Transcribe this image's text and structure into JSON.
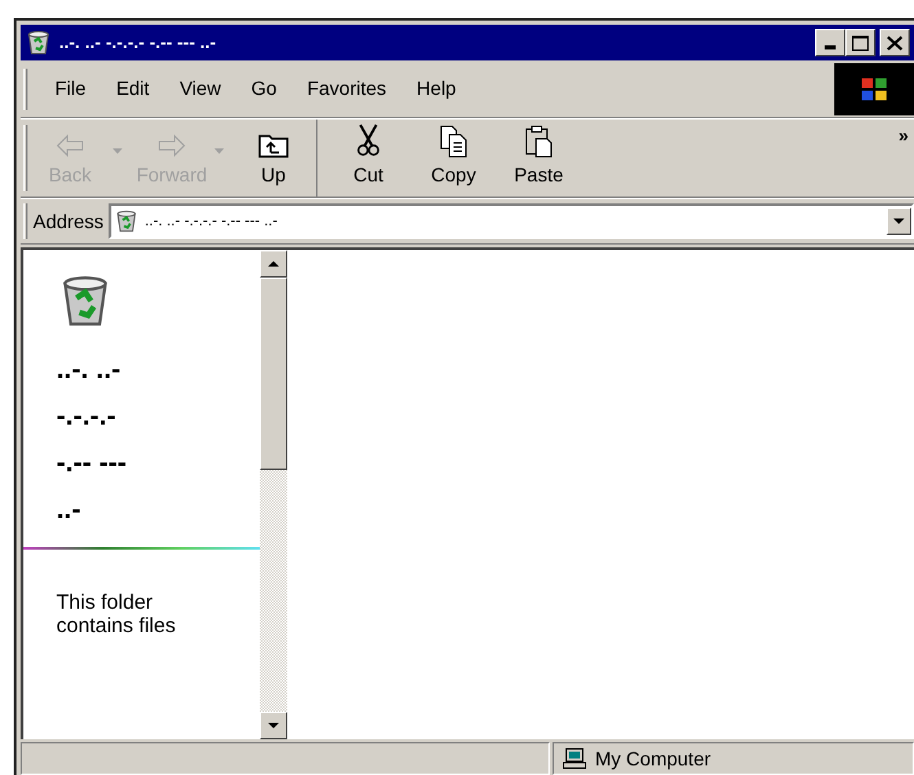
{
  "window": {
    "title": "..-. ..- -.-.-.- -.-- --- ..-"
  },
  "menu": [
    {
      "label": "File"
    },
    {
      "label": "Edit"
    },
    {
      "label": "View"
    },
    {
      "label": "Go"
    },
    {
      "label": "Favorites"
    },
    {
      "label": "Help"
    }
  ],
  "toolbar": {
    "buttons": [
      {
        "kind": "back",
        "label": "Back",
        "disabled": true,
        "dropdown": true
      },
      {
        "kind": "forward",
        "label": "Forward",
        "disabled": true,
        "dropdown": true
      },
      {
        "kind": "up",
        "label": "Up",
        "disabled": false,
        "dropdown": false
      },
      {
        "kind": "cut",
        "label": "Cut",
        "disabled": false,
        "dropdown": false
      },
      {
        "kind": "copy",
        "label": "Copy",
        "disabled": false,
        "dropdown": false
      },
      {
        "kind": "paste",
        "label": "Paste",
        "disabled": false,
        "dropdown": false
      }
    ],
    "more": "»"
  },
  "address": {
    "label": "Address",
    "value": "..-. ..- -.-.-.- -.-- --- ..-"
  },
  "sidebar": {
    "title_lines": [
      "..-. ..-",
      "-.-.-.-",
      "-.-- ---",
      "..-"
    ],
    "description": "This folder contains files"
  },
  "status_bar": {
    "zone": "My Computer"
  }
}
